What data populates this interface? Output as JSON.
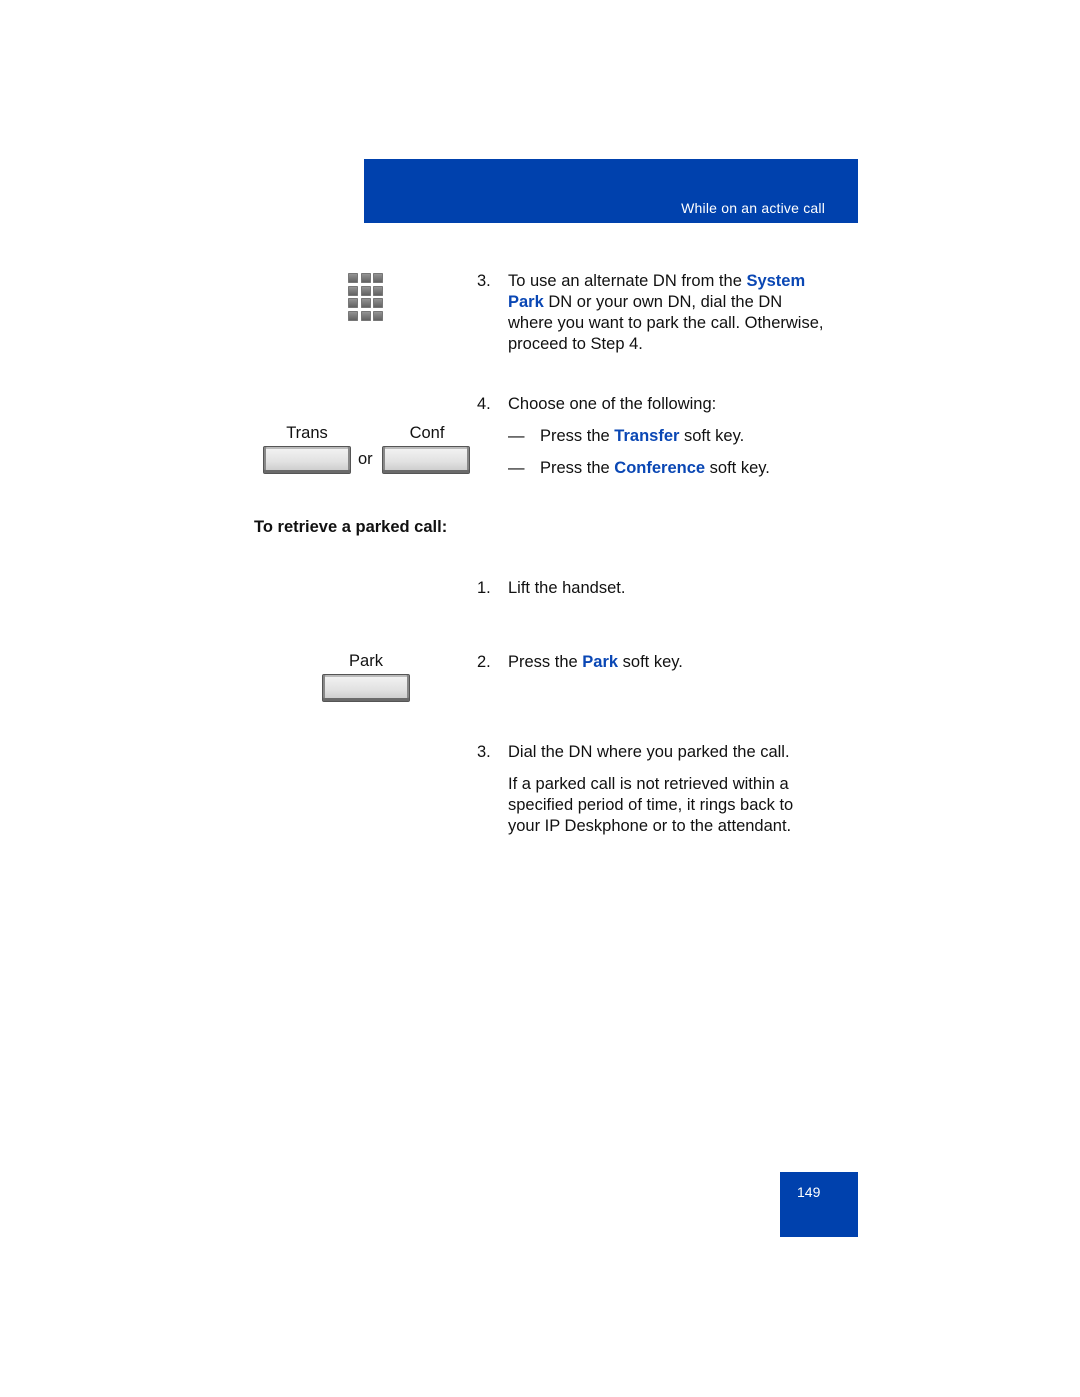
{
  "header": {
    "section_title": "While on an active call"
  },
  "park_steps": {
    "step3": {
      "number": "3.",
      "text_before": "To use an alternate DN from the ",
      "highlight": "System Park",
      "text_after": " DN or your own DN, dial the DN where you want to park the call. Otherwise, proceed to Step 4.",
      "icon": "dialpad-icon"
    },
    "step4": {
      "number": "4.",
      "text": "Choose one of the following:",
      "options": [
        {
          "dash": "—",
          "prefix": "Press the ",
          "highlight": "Transfer",
          "suffix": " soft key."
        },
        {
          "dash": "—",
          "prefix": "Press the ",
          "highlight": "Conference",
          "suffix": " soft key."
        }
      ],
      "softkeys": [
        {
          "label": "Trans"
        },
        {
          "label": "Conf"
        }
      ],
      "or_label": "or"
    }
  },
  "retrieve": {
    "heading": "To retrieve a parked call:",
    "steps": [
      {
        "number": "1.",
        "text": "Lift the handset."
      },
      {
        "number": "2.",
        "prefix": "Press the ",
        "highlight": "Park",
        "suffix": " soft key.",
        "softkey_label": "Park"
      },
      {
        "number": "3.",
        "text": "Dial the DN where you parked the call.",
        "note": "If a parked call is not retrieved within a specified period of time, it rings back to your IP Deskphone or to the attendant."
      }
    ]
  },
  "footer": {
    "page_number": "149"
  },
  "colors": {
    "brand_blue": "#0041ad",
    "highlight_blue": "#0a47b4"
  }
}
